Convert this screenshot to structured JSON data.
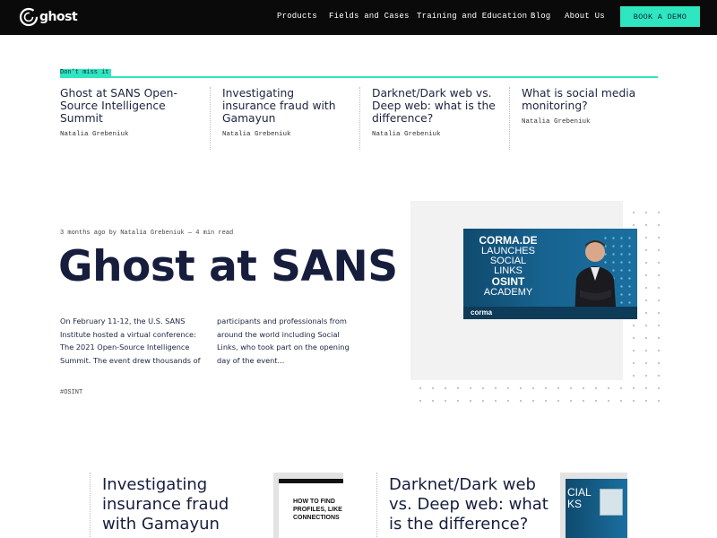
{
  "nav": {
    "logo_text": "ghost",
    "links": [
      "Products",
      "Fields and Cases",
      "Training and Education",
      "Blog",
      "About Us"
    ],
    "cta": "BOOK A DEMO"
  },
  "dont_miss": {
    "label": "Don't miss it",
    "cards": [
      {
        "title": "Ghost at SANS Open-Source Intelligence Summit",
        "author": "Natalia Grebeniuk"
      },
      {
        "title": "Investigating insurance fraud with Gamayun",
        "author": "Natalia Grebeniuk"
      },
      {
        "title": "Darknet/Dark web vs. Deep web: what is the difference?",
        "author": "Natalia Grebeniuk"
      },
      {
        "title": "What is social media monitoring?",
        "author": "Natalia Grebeniuk"
      }
    ]
  },
  "featured": {
    "meta": "3 months ago by Natalia Grebeniuk — 4 min read",
    "title": "Ghost at SANS",
    "excerpt_col1": "On February 11-12, the U.S. SANS Institute hosted a virtual conference: The 2021 Open-Source Intelligence Summit. The event drew thousands of",
    "excerpt_col2": "participants and professionals from around the world including Social Links, who took part on the opening day of the event...",
    "tag": "#OSINT",
    "image": {
      "line1": "CORMA.DE",
      "line2": "LAUNCHES",
      "line3": "SOCIAL",
      "line4": "LINKS",
      "line5": "OSINT",
      "line6": "ACADEMY",
      "brand": "corma"
    }
  },
  "bottom_cards": [
    {
      "title": "Investigating insurance fraud with Gamayun",
      "thumb_text": "HOW TO FIND PROFILES, LIKE CONNECTIONS"
    },
    {
      "title": "Darknet/Dark web vs. Deep web: what is the difference?",
      "thumb_text": "CIAL KS"
    }
  ],
  "colors": {
    "accent": "#2ee6c0",
    "nav_bg": "#0a0a0a",
    "text": "#1c2340"
  }
}
